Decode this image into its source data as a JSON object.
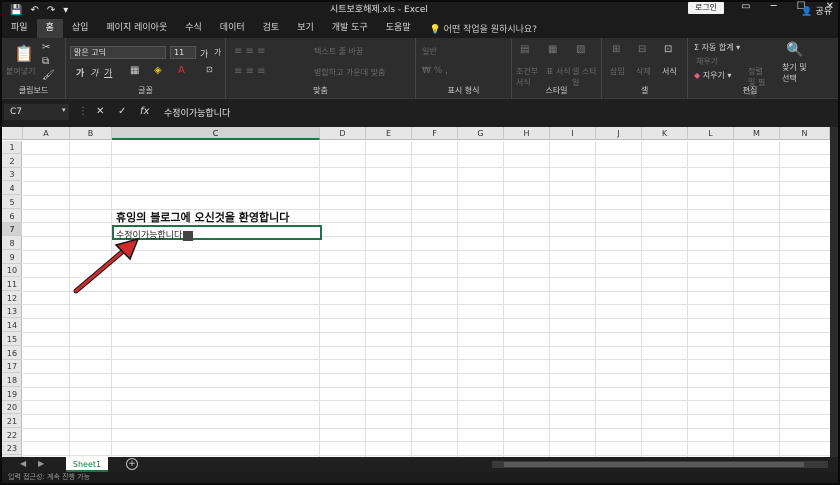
{
  "window": {
    "title": "시트보호해제.xls  -  Excel",
    "login_label": "로그인",
    "controls": [
      "▭",
      "─",
      "☐",
      "✕"
    ]
  },
  "quick_access": [
    "save-icon",
    "undo-icon",
    "redo-icon",
    "customize-icon"
  ],
  "tabs": [
    "파일",
    "홈",
    "삽입",
    "페이지 레이아웃",
    "수식",
    "데이터",
    "검토",
    "보기",
    "개발 도구",
    "도움말"
  ],
  "active_tab": "홈",
  "tell_me": "어떤 작업을 원하시나요?",
  "share_label": "공유",
  "ribbon": {
    "clipboard": {
      "label": "클립보드",
      "paste": "붙여넣기"
    },
    "font": {
      "label": "글꼴",
      "name": "맑은 고딕",
      "size": "11",
      "grow": "가",
      "shrink": "가",
      "bold": "가",
      "italic": "가",
      "underline": "가"
    },
    "alignment": {
      "label": "맞춤",
      "wrap": "텍스트 줄 바꿈",
      "merge": "병합하고 가운데 맞춤"
    },
    "number": {
      "label": "표시 형식",
      "format": "일반"
    },
    "styles": {
      "label": "스타일",
      "conditional": "조건부 서식",
      "table": "표 서식",
      "cell": "셀 스타일"
    },
    "cells": {
      "label": "셀",
      "insert": "삽입",
      "delete": "삭제",
      "format": "서식"
    },
    "editing": {
      "label": "편집",
      "autosum": "자동 합계",
      "fill": "채우기",
      "clear": "지우기",
      "sort": "정렬 및 필터",
      "find": "찾기 및 선택"
    }
  },
  "formula_bar": {
    "name_box": "C7",
    "content": "수정이가능합니다"
  },
  "columns": [
    "A",
    "B",
    "C",
    "D",
    "E",
    "F",
    "G",
    "H",
    "I",
    "J",
    "K",
    "L",
    "M",
    "N"
  ],
  "selected_column": "C",
  "rows": [
    "1",
    "2",
    "3",
    "4",
    "5",
    "6",
    "7",
    "8",
    "9",
    "10",
    "11",
    "12",
    "13",
    "14",
    "15",
    "16",
    "17",
    "18",
    "19",
    "20",
    "21",
    "22",
    "23"
  ],
  "selected_row": "7",
  "cells": {
    "C6": "휴잉의 블로그에 오신것을 환영합니다",
    "C7": "수정이가능합니다"
  },
  "sheet": {
    "name": "Sheet1"
  },
  "status": {
    "text": "입력   접근성: 계속 진행 가능"
  },
  "colors": {
    "accent": "#217346",
    "arrow": "#d22a2a"
  }
}
